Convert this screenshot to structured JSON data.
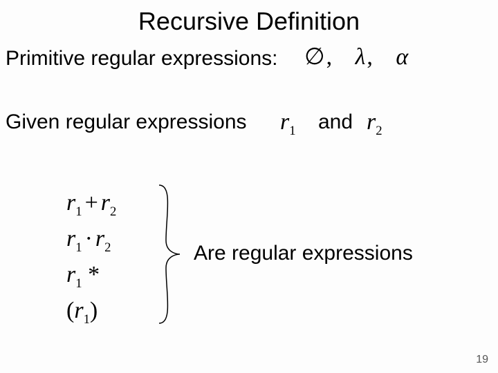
{
  "title": "Recursive Definition",
  "line_primitive": "Primitive regular expressions:",
  "primitives": {
    "empty_set": "∅",
    "comma1": ",",
    "lambda": "λ",
    "comma2": ",",
    "alpha": "α"
  },
  "line_given": "Given regular expressions",
  "r1": {
    "base": "r",
    "sub": "1"
  },
  "and": "and",
  "r2": {
    "base": "r",
    "sub": "2"
  },
  "ops": {
    "row1": {
      "a": "r",
      "a_sub": "1",
      "op": "+",
      "b": "r",
      "b_sub": "2"
    },
    "row2": {
      "a": "r",
      "a_sub": "1",
      "op": "·",
      "b": "r",
      "b_sub": "2"
    },
    "row3": {
      "a": "r",
      "a_sub": "1",
      "op": "*"
    },
    "row4": {
      "lp": "(",
      "a": "r",
      "a_sub": "1",
      "rp": ")"
    }
  },
  "conclusion": "Are regular expressions",
  "page_number": "19"
}
